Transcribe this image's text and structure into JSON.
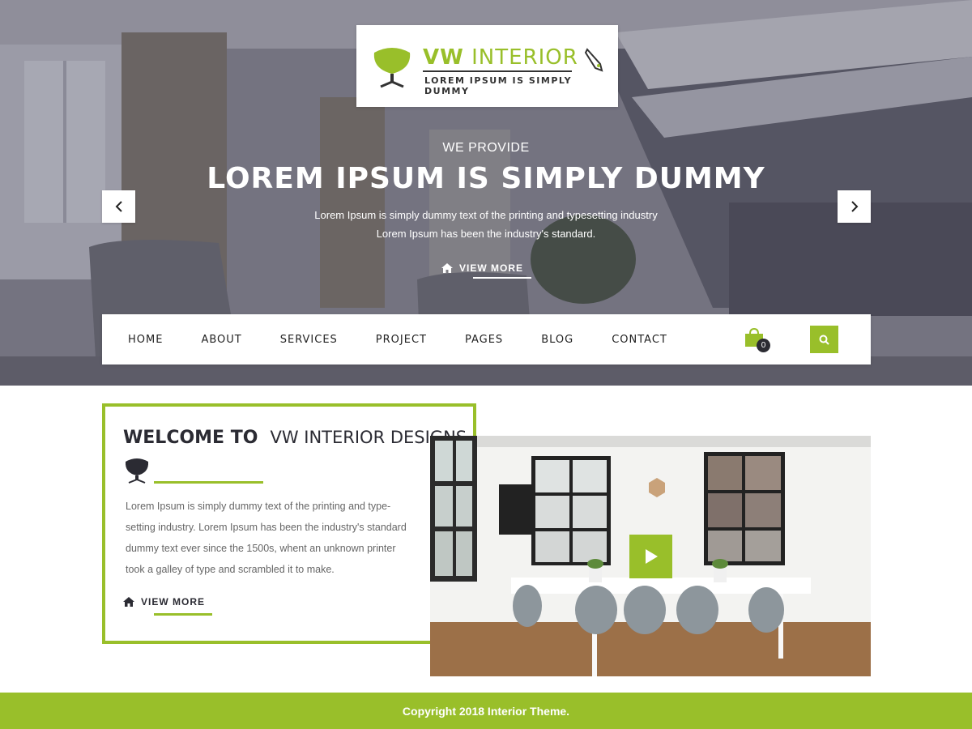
{
  "logo": {
    "brand_bold": "VW",
    "brand_thin": "INTERIOR",
    "tagline": "LOREM IPSUM IS SIMPLY DUMMY",
    "icon": "chair-icon"
  },
  "slider": {
    "subtitle": "WE PROVIDE",
    "title": "LOREM IPSUM IS SIMPLY DUMMY",
    "desc_line1": "Lorem Ipsum is simply dummy text of the printing and typesetting industry",
    "desc_line2": "Lorem Ipsum has been the industry's standard.",
    "button_label": "VIEW MORE",
    "prev_icon": "chevron-left-icon",
    "next_icon": "chevron-right-icon"
  },
  "nav": {
    "items": [
      {
        "label": "HOME"
      },
      {
        "label": "ABOUT"
      },
      {
        "label": "SERVICES"
      },
      {
        "label": "PROJECT"
      },
      {
        "label": "PAGES"
      },
      {
        "label": "BLOG"
      },
      {
        "label": "CONTACT"
      }
    ],
    "cart_count": "0",
    "cart_icon": "shopping-bag-icon",
    "search_icon": "search-icon"
  },
  "welcome": {
    "title_bold": "WELCOME TO",
    "title_thin": "VW INTERIOR DESIGNS",
    "text": "Lorem Ipsum is simply dummy text of the printing and type-setting industry. Lorem Ipsum has been the industry's standard dummy text ever since the 1500s, whent an unknown printer took a galley of type and scrambled it to make.",
    "button_label": "VIEW MORE",
    "play_icon": "play-icon"
  },
  "footer": {
    "copyright": "Copyright 2018  Interior Theme."
  },
  "colors": {
    "accent": "#99bf2a",
    "dark": "#2b2b33"
  }
}
